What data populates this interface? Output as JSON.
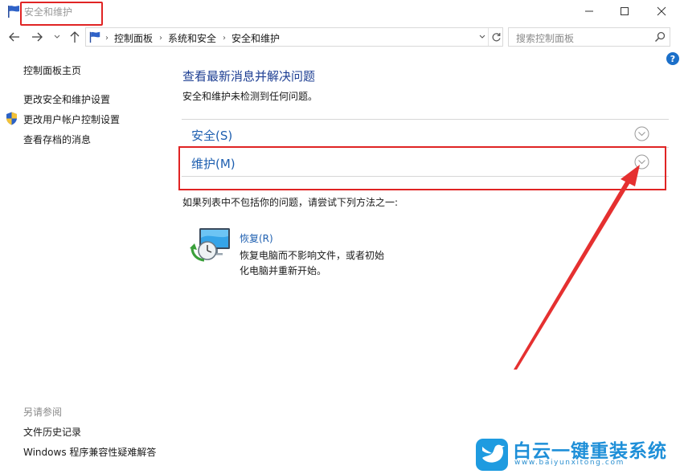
{
  "window": {
    "title": "安全和维护",
    "controls": {
      "minimize": "—",
      "maximize": "☐",
      "close": "✕"
    }
  },
  "nav": {
    "back_icon": "arrow-left-icon",
    "forward_icon": "arrow-right-icon",
    "up_icon": "arrow-up-icon",
    "breadcrumb": [
      "控制面板",
      "系统和安全",
      "安全和维护"
    ],
    "search_placeholder": "搜索控制面板"
  },
  "help": {
    "label": "?"
  },
  "sidebar": {
    "items": [
      "控制面板主页",
      "更改安全和维护设置",
      "更改用户帐户控制设置",
      "查看存档的消息"
    ],
    "see_also_heading": "另请参阅",
    "see_also": [
      "文件历史记录",
      "Windows 程序兼容性疑难解答"
    ]
  },
  "main": {
    "title": "查看最新消息并解决问题",
    "subtitle": "安全和维护未检测到任何问题。",
    "sections": [
      {
        "label": "安全(S)"
      },
      {
        "label": "维护(M)"
      }
    ],
    "hint": "如果列表中不包括你的问题，请尝试下列方法之一:",
    "recovery": {
      "link": "恢复(R)",
      "desc_line1": "恢复电脑而不影响文件，或者初始",
      "desc_line2": "化电脑并重新开始。"
    }
  },
  "annotation": {
    "highlight_color": "#e02424"
  },
  "watermark": {
    "brand": "白云一键重装系统",
    "url": "www.baiyunxitong.com"
  }
}
